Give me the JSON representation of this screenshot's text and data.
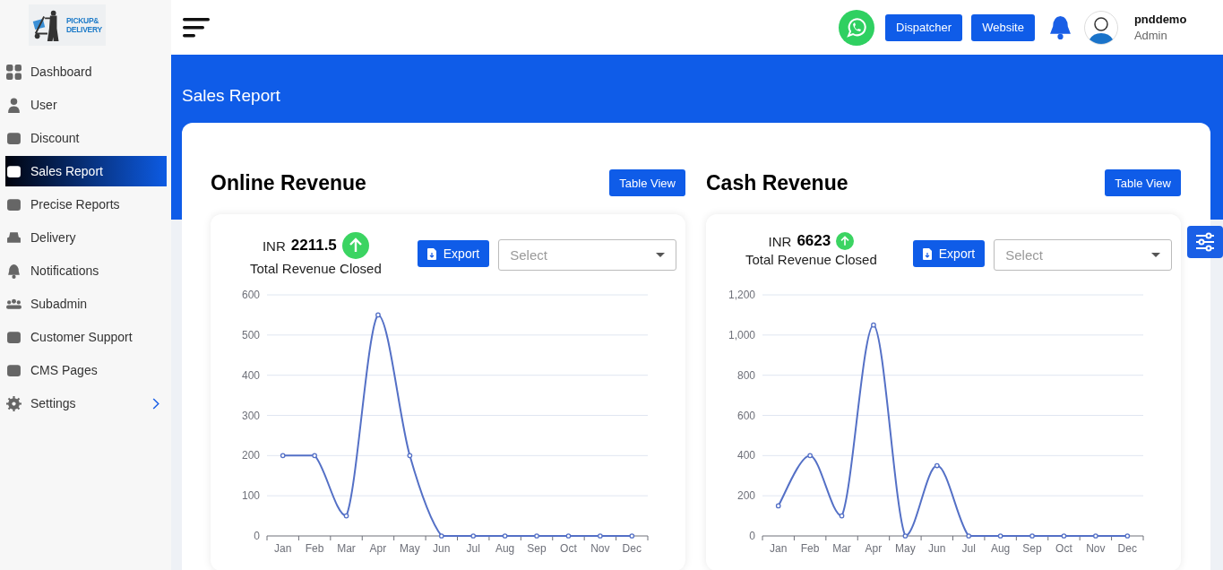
{
  "logo": {
    "line1": "PICKUP&",
    "line2": "DELIVERY"
  },
  "sidebar": {
    "items": [
      {
        "label": "Dashboard",
        "selected": false,
        "has_submenu": false
      },
      {
        "label": "User",
        "selected": false,
        "has_submenu": false
      },
      {
        "label": "Discount",
        "selected": false,
        "has_submenu": false
      },
      {
        "label": "Sales Report",
        "selected": true,
        "has_submenu": false
      },
      {
        "label": "Precise Reports",
        "selected": false,
        "has_submenu": false
      },
      {
        "label": "Delivery",
        "selected": false,
        "has_submenu": false
      },
      {
        "label": "Notifications",
        "selected": false,
        "has_submenu": false
      },
      {
        "label": "Subadmin",
        "selected": false,
        "has_submenu": false
      },
      {
        "label": "Customer Support",
        "selected": false,
        "has_submenu": false
      },
      {
        "label": "CMS Pages",
        "selected": false,
        "has_submenu": false
      },
      {
        "label": "Settings",
        "selected": false,
        "has_submenu": true
      }
    ]
  },
  "header": {
    "buttons": [
      "Dispatcher",
      "Website"
    ],
    "user": {
      "name": "pnddemo",
      "role": "Admin"
    }
  },
  "page_title": "Sales Report",
  "panels": [
    {
      "title": "Online Revenue",
      "view_button": "Table View",
      "currency": "INR",
      "amount": "2211.5",
      "caption": "Total Revenue Closed",
      "export_button": "Export",
      "select": {
        "placeholder": "Select"
      },
      "chart_data": {
        "type": "line",
        "categories": [
          "Jan",
          "Feb",
          "Mar",
          "Apr",
          "May",
          "Jun",
          "Jul",
          "Aug",
          "Sep",
          "Oct",
          "Nov",
          "Dec"
        ],
        "series": [
          {
            "color": "#5470c6",
            "marker": true,
            "values": [
              200,
              200,
              50,
              550,
              200,
              0,
              0,
              0,
              0,
              0,
              0,
              0
            ]
          }
        ],
        "grid": true,
        "ylim": [
          0,
          600
        ],
        "yticks": [
          0,
          100,
          200,
          300,
          400,
          500,
          600
        ]
      }
    },
    {
      "title": "Cash Revenue",
      "view_button": "Table View",
      "currency": "INR",
      "amount": "6623",
      "caption": "Total Revenue Closed",
      "export_button": "Export",
      "select": {
        "placeholder": "Select"
      },
      "chart_data": {
        "type": "line",
        "categories": [
          "Jan",
          "Feb",
          "Mar",
          "Apr",
          "May",
          "Jun",
          "Jul",
          "Aug",
          "Sep",
          "Oct",
          "Nov",
          "Dec"
        ],
        "series": [
          {
            "color": "#5470c6",
            "marker": true,
            "values": [
              150,
              400,
              100,
              1050,
              0,
              350,
              0,
              0,
              0,
              0,
              0,
              0
            ]
          }
        ],
        "grid": true,
        "ylim": [
          0,
          1200
        ],
        "yticks": [
          0,
          200,
          400,
          600,
          800,
          {
            "value": 1000,
            "label": "1,000"
          },
          {
            "value": 1200,
            "label": "1,200"
          }
        ]
      }
    }
  ]
}
